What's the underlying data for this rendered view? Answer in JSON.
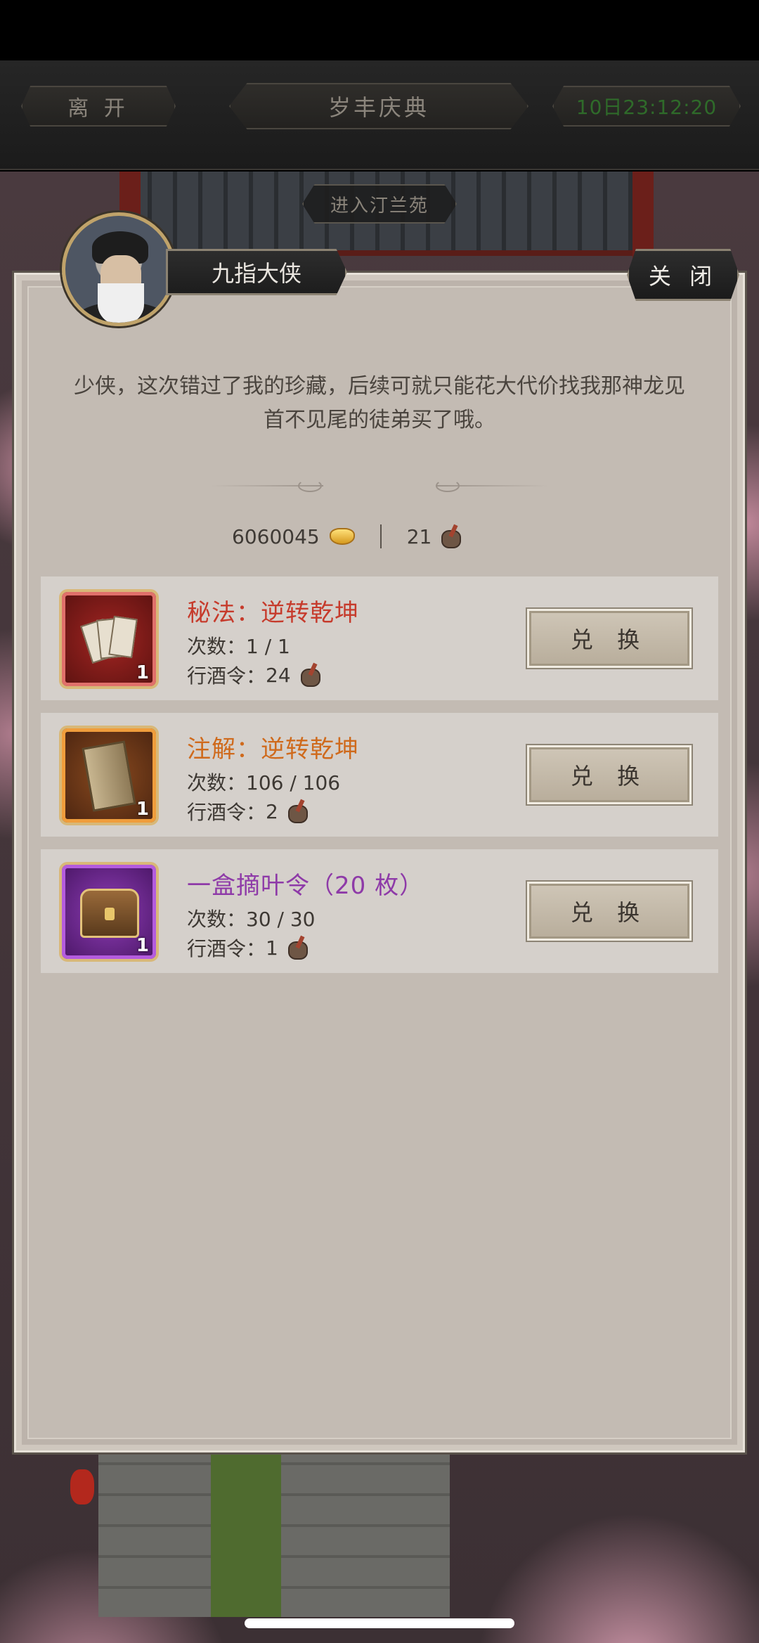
{
  "topbar": {
    "leave_label": "离 开",
    "event_title": "岁丰庆典",
    "timer": "10日23:12:20"
  },
  "scene": {
    "enter_garden_label": "进入汀兰苑"
  },
  "npc": {
    "name": "九指大侠",
    "dialogue": "少侠，这次错过了我的珍藏，后续可就只能花大代价找我那神龙见首不见尾的徒弟买了哦。"
  },
  "modal": {
    "close_label": "关 闭"
  },
  "currency": {
    "ingots": "6060045",
    "wine_tokens": "21",
    "ingot_icon": "gold-ingot-icon",
    "token_icon": "wine-token-icon"
  },
  "items": [
    {
      "name": "秘法：逆转乾坤",
      "count": "次数：1 / 1",
      "cost_label": "行酒令：",
      "cost": "24",
      "qty": "1",
      "button": "兑 换",
      "color": "#c63b2c",
      "icon": "manuscripts-icon"
    },
    {
      "name": "注解：逆转乾坤",
      "count": "次数：106 / 106",
      "cost_label": "行酒令：",
      "cost": "2",
      "qty": "1",
      "button": "兑 换",
      "color": "#cf6a1c",
      "icon": "book-icon"
    },
    {
      "name": "一盒摘叶令（20 枚）",
      "count": "次数：30 / 30",
      "cost_label": "行酒令：",
      "cost": "1",
      "qty": "1",
      "button": "兑 换",
      "color": "#8e3aa8",
      "icon": "treasure-chest-icon"
    }
  ]
}
